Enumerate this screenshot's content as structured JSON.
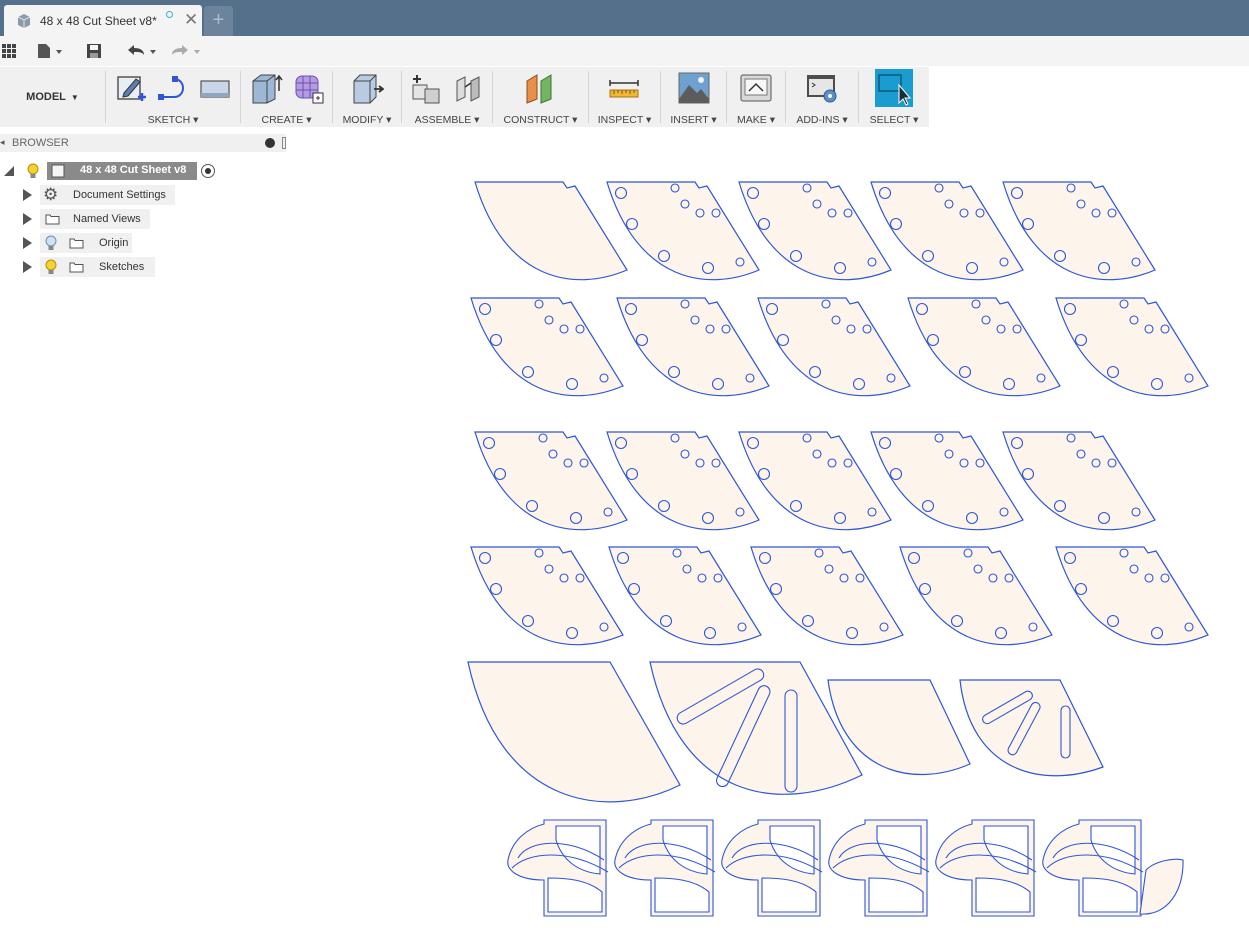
{
  "document_tab": {
    "title": "48 x 48 Cut Sheet v8*"
  },
  "new_tab_label": "+",
  "toolbar": {
    "workspace": "MODEL",
    "groups": {
      "sketch": "SKETCH",
      "create": "CREATE",
      "modify": "MODIFY",
      "assemble": "ASSEMBLE",
      "construct": "CONSTRUCT",
      "inspect": "INSPECT",
      "insert": "INSERT",
      "make": "MAKE",
      "addins": "ADD-INS",
      "select": "SELECT"
    }
  },
  "browser": {
    "header": "BROWSER",
    "root": "48 x 48 Cut Sheet v8",
    "items": [
      {
        "label": "Document Settings",
        "icon": "gear-icon"
      },
      {
        "label": "Named Views",
        "icon": "folder-icon"
      },
      {
        "label": "Origin",
        "icon": "folder-icon"
      },
      {
        "label": "Sketches",
        "icon": "folder-icon"
      }
    ]
  },
  "colors": {
    "tab_bar": "#55708b",
    "sketch_line": "#2f56d6",
    "part_fill": "#fdf5ec",
    "select_accent": "#1b9cd0"
  }
}
